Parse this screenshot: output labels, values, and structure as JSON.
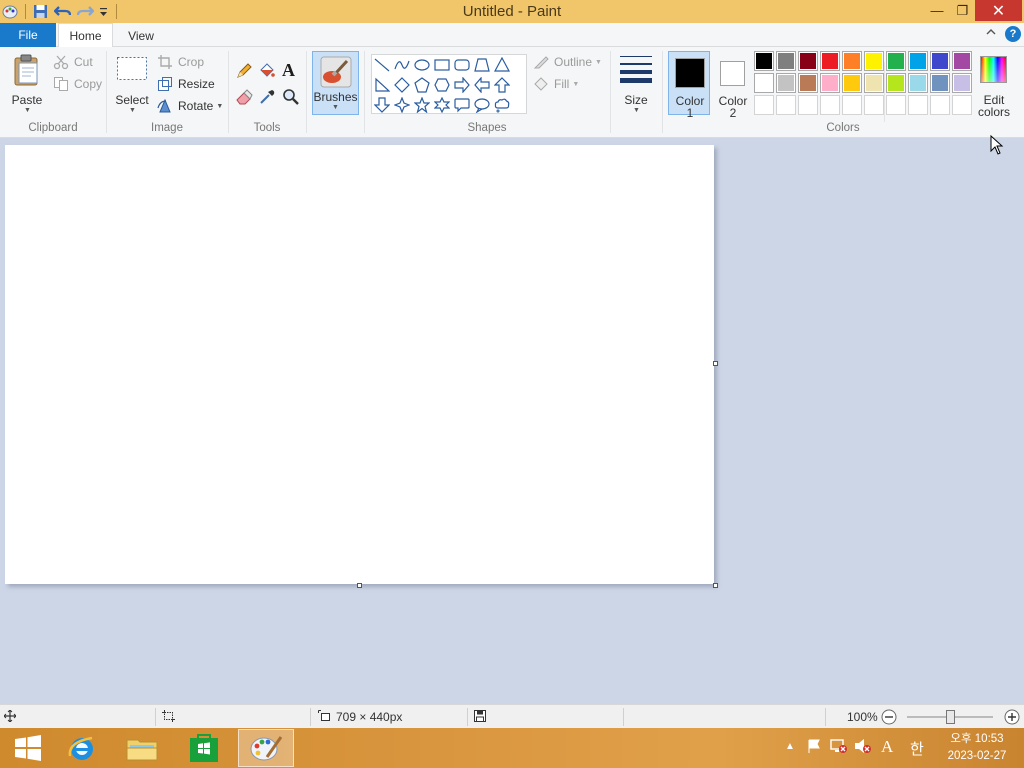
{
  "window": {
    "title": "Untitled - Paint",
    "controls": {
      "minimize": "—",
      "restore": "❐",
      "close": "✕"
    }
  },
  "ribbon": {
    "tabs": {
      "file": "File",
      "home": "Home",
      "view": "View"
    },
    "help": "?",
    "clipboard": {
      "paste": "Paste",
      "cut": "Cut",
      "copy": "Copy",
      "label": "Clipboard"
    },
    "image": {
      "select": "Select",
      "crop": "Crop",
      "resize": "Resize",
      "rotate": "Rotate",
      "label": "Image"
    },
    "tools": {
      "label": "Tools",
      "text_tool": "A"
    },
    "brushes": {
      "label": "Brushes"
    },
    "shapes": {
      "outline": "Outline",
      "fill": "Fill",
      "label": "Shapes"
    },
    "size": {
      "label": "Size"
    },
    "colors": {
      "color1_line1": "Color",
      "color1_line2": "1",
      "color2_line1": "Color",
      "color2_line2": "2",
      "edit_line1": "Edit",
      "edit_line2": "colors",
      "label": "Colors",
      "color1_value": "#000000",
      "color2_value": "#ffffff",
      "palette": [
        [
          "#000000",
          "#7f7f7f",
          "#880015",
          "#ed1c24",
          "#ff7f27",
          "#fff200",
          "#22b14c",
          "#00a2e8",
          "#3f48cc",
          "#a349a4"
        ],
        [
          "#ffffff",
          "#c3c3c3",
          "#b97a57",
          "#ffaec9",
          "#ffc90e",
          "#efe4b0",
          "#b5e61d",
          "#99d9ea",
          "#7092be",
          "#c8bfe7"
        ],
        [
          "",
          "",
          "",
          "",
          "",
          "",
          "",
          "",
          "",
          ""
        ]
      ]
    }
  },
  "statusbar": {
    "dimensions": "709 × 440px",
    "zoom": "100%"
  },
  "taskbar": {
    "ime": "A",
    "hangul": "한",
    "clock_line1": "오후 10:53",
    "clock_line2": "2023-02-27"
  }
}
